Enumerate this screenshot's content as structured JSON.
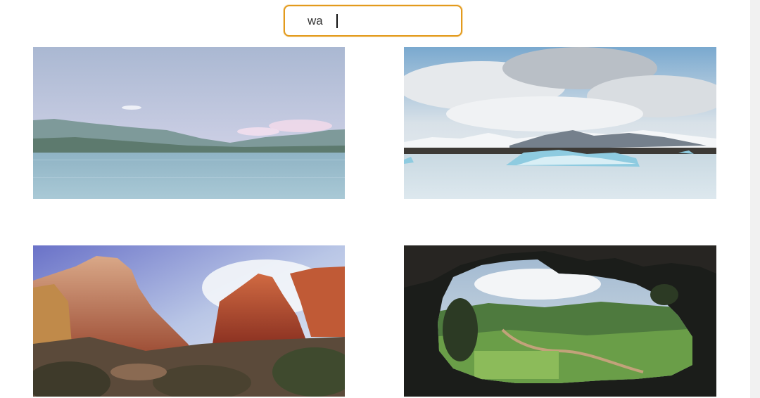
{
  "search": {
    "value": "wa",
    "accent_color": "#e39a1c"
  },
  "gallery": {
    "images": [
      {
        "subject": "lake-mountains-photo"
      },
      {
        "subject": "glacier-lagoon-photo"
      },
      {
        "subject": "red-rock-canyon-photo"
      },
      {
        "subject": "cave-opening-valley-photo"
      }
    ]
  }
}
